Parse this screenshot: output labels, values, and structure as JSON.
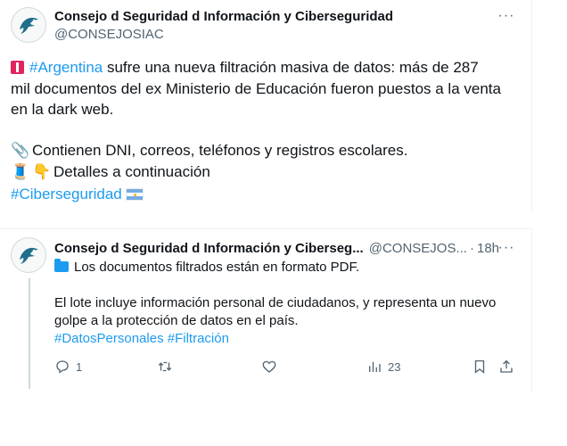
{
  "tweet1": {
    "author_name": "Consejo d Seguridad d Información y Ciberseguridad",
    "handle": "@CONSEJOSIAC",
    "line1_hashtag": "#Argentina",
    "line1_text": " sufre una nueva filtración masiva de datos: más de 287",
    "line2": "mil documentos del ex Ministerio de Educación fueron puestos a la venta",
    "line3": "en la dark web.",
    "line4": "Contienen DNI, correos, teléfonos y registros escolares.",
    "line5": "Detalles a continuación",
    "hashtag": "#Ciberseguridad",
    "emoji_clip": "📎",
    "emoji_thread": "🧵",
    "emoji_point": "👇"
  },
  "tweet2": {
    "author_name": "Consejo d Seguridad d Información y Ciberseg...",
    "handle": "@CONSEJOS...",
    "dot": "·",
    "time": "18h",
    "line1": "Los documentos filtrados están en formato PDF.",
    "line2": "El lote incluye información personal de ciudadanos, y representa un nuevo",
    "line3": "golpe a la protección de datos en el país.",
    "hashtags": "#DatosPersonales #Filtración",
    "reply_count": "1",
    "view_count": "23"
  },
  "more_icon": "···",
  "colors": {
    "link": "#1d9bf0",
    "muted": "#536471",
    "text": "#0f1419"
  }
}
